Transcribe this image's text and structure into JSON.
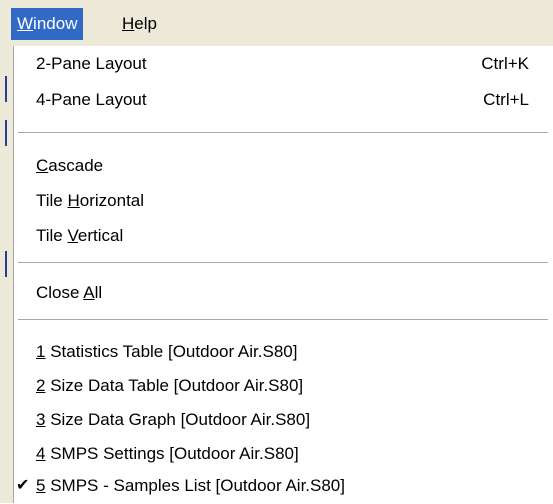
{
  "menubar": {
    "window_mnemonic": "W",
    "window_rest": "indow",
    "help_mnemonic": "H",
    "help_rest": "elp"
  },
  "menu": {
    "layout": [
      {
        "label": "2-Pane Layout",
        "shortcut": "Ctrl+K"
      },
      {
        "label": "4-Pane Layout",
        "shortcut": "Ctrl+L"
      }
    ],
    "arrange": [
      {
        "pre": "",
        "u": "C",
        "post": "ascade"
      },
      {
        "pre": "Tile ",
        "u": "H",
        "post": "orizontal"
      },
      {
        "pre": "Tile ",
        "u": "V",
        "post": "ertical"
      }
    ],
    "close_all": {
      "pre": "Close ",
      "u": "A",
      "post": "ll"
    },
    "windows": [
      {
        "num": "1",
        "title": " Statistics Table  [Outdoor Air.S80]",
        "checked": false
      },
      {
        "num": "2",
        "title": " Size Data Table  [Outdoor Air.S80]",
        "checked": false
      },
      {
        "num": "3",
        "title": " Size Data Graph  [Outdoor Air.S80]",
        "checked": false
      },
      {
        "num": "4",
        "title": " SMPS Settings  [Outdoor Air.S80]",
        "checked": false
      },
      {
        "num": "5",
        "title": " SMPS - Samples List  [Outdoor Air.S80]",
        "checked": true
      }
    ],
    "check_glyph": "✔"
  },
  "colors": {
    "highlight": "#316ac5",
    "menubar_bg": "#ece9d8",
    "separator": "#aca899"
  }
}
